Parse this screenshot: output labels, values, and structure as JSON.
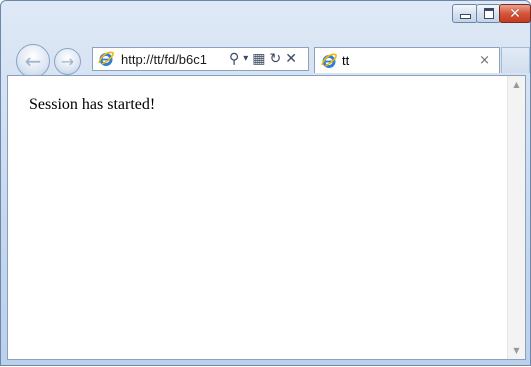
{
  "window": {
    "caption_buttons": {
      "minimize_icon": "minimize-icon",
      "maximize_icon": "maximize-icon",
      "close_icon": "close-icon",
      "close_glyph": "✕"
    }
  },
  "nav": {
    "back_glyph": "←",
    "forward_glyph": "→"
  },
  "address_bar": {
    "url": "http://tt/fd/b6c1",
    "search_glyph": "⚲",
    "dropdown_glyph": "▾",
    "compat_glyph": "▦",
    "refresh_glyph": "↻",
    "stop_glyph": "✕"
  },
  "tabs": [
    {
      "title": "tt",
      "close_glyph": "×",
      "active": true
    }
  ],
  "page": {
    "body_text": "Session has started!"
  },
  "scrollbar": {
    "up_glyph": "▲",
    "down_glyph": "▼"
  },
  "colors": {
    "frame": "#c7d8ee",
    "close_button": "#c53b1f",
    "ie_blue": "#2b7fd4",
    "ie_gold": "#f2b705"
  }
}
